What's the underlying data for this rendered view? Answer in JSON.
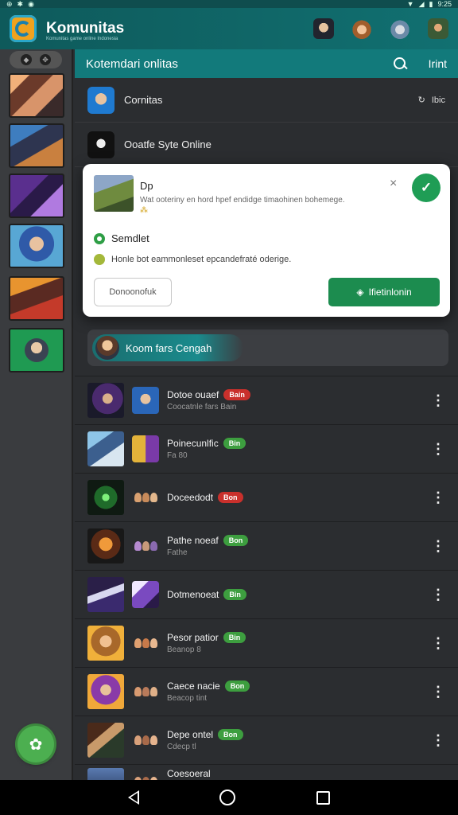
{
  "status_bar": {
    "time": "9:25"
  },
  "app": {
    "title": "Komunitas",
    "subtitle": "Komunitas game online Indonesia"
  },
  "main_header": {
    "title": "Kotemdari onlitas",
    "action": "Irint"
  },
  "channels": [
    {
      "label": "Cornitas",
      "right_text": "Ibic"
    },
    {
      "label": "Ooatfe Syte Online"
    }
  ],
  "dialog": {
    "title": "Dp",
    "description": "Wat ooteriny en hord hpef endidge timaohinen bohemege.",
    "option1": "Semdlet",
    "option2": "Honle bot eammonleset epcandefraté oderige.",
    "secondary_button": "Donoonofuk",
    "primary_button": "Ifietinlonin",
    "close_symbol": "×",
    "check_symbol": "✓"
  },
  "community_pill": {
    "label": "Koom fars Cengah"
  },
  "rows": [
    {
      "title": "Dotoe ouaef",
      "badge": "Bain",
      "badge_color": "red",
      "subtitle": "Coocatnle fars Bain"
    },
    {
      "title": "Poinecunlfic",
      "badge": "Bin",
      "badge_color": "green",
      "subtitle": "Fa 80"
    },
    {
      "title": "Doceedodt",
      "badge": "Bon",
      "badge_color": "red",
      "subtitle": ""
    },
    {
      "title": "Pathe noeaf",
      "badge": "Bon",
      "badge_color": "green",
      "subtitle": "Fathe"
    },
    {
      "title": "Dotmenoeat",
      "badge": "Bin",
      "badge_color": "green",
      "subtitle": ""
    },
    {
      "title": "Pesor patior",
      "badge": "Bin",
      "badge_color": "green",
      "subtitle": "Beanop 8"
    },
    {
      "title": "Caece nacie",
      "badge": "Bon",
      "badge_color": "green",
      "subtitle": "Beacop tint"
    },
    {
      "title": "Depe ontel",
      "badge": "Bon",
      "badge_color": "green",
      "subtitle": "Cdecp tl"
    },
    {
      "title": "Coesoeral",
      "badge": "",
      "badge_color": "green",
      "subtitle": ""
    }
  ],
  "colors": {
    "teal": "#127a7b",
    "green": "#1c8c4f",
    "badge_red": "#c9302c",
    "badge_green": "#3d9e3f"
  }
}
